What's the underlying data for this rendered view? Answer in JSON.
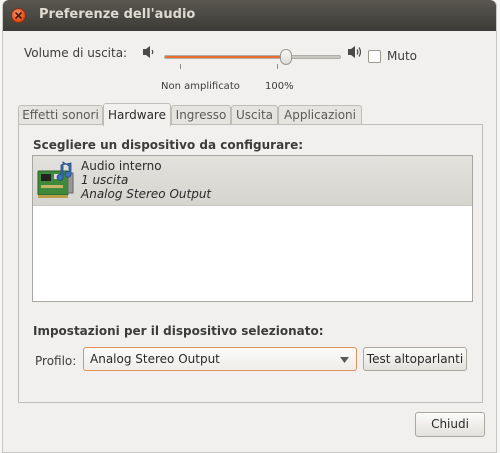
{
  "window": {
    "title": "Preferenze dell'audio"
  },
  "volume": {
    "label": "Volume di uscita:",
    "level_percent": 69,
    "tick_unamplified": "Non amplificato",
    "tick_100": "100%",
    "mute_label": "Muto",
    "mute_checked": false
  },
  "tabs": [
    {
      "label": "Effetti sonori",
      "active": false
    },
    {
      "label": "Hardware",
      "active": true
    },
    {
      "label": "Ingresso",
      "active": false
    },
    {
      "label": "Uscita",
      "active": false
    },
    {
      "label": "Applicazioni",
      "active": false
    }
  ],
  "hardware": {
    "choose_heading": "Scegliere un dispositivo da configurare:",
    "devices": [
      {
        "name": "Audio interno",
        "outputs": "1 uscita",
        "profile": "Analog Stereo Output",
        "selected": true
      }
    ],
    "settings_heading": "Impostazioni per il dispositivo selezionato:",
    "profile_label": "Profilo:",
    "profile_value": "Analog Stereo Output",
    "test_button": "Test altoparlanti"
  },
  "footer": {
    "close_button": "Chiudi"
  },
  "colors": {
    "accent": "#e86d31",
    "titlebar": "#3c3b37",
    "close": "#e5521f"
  }
}
